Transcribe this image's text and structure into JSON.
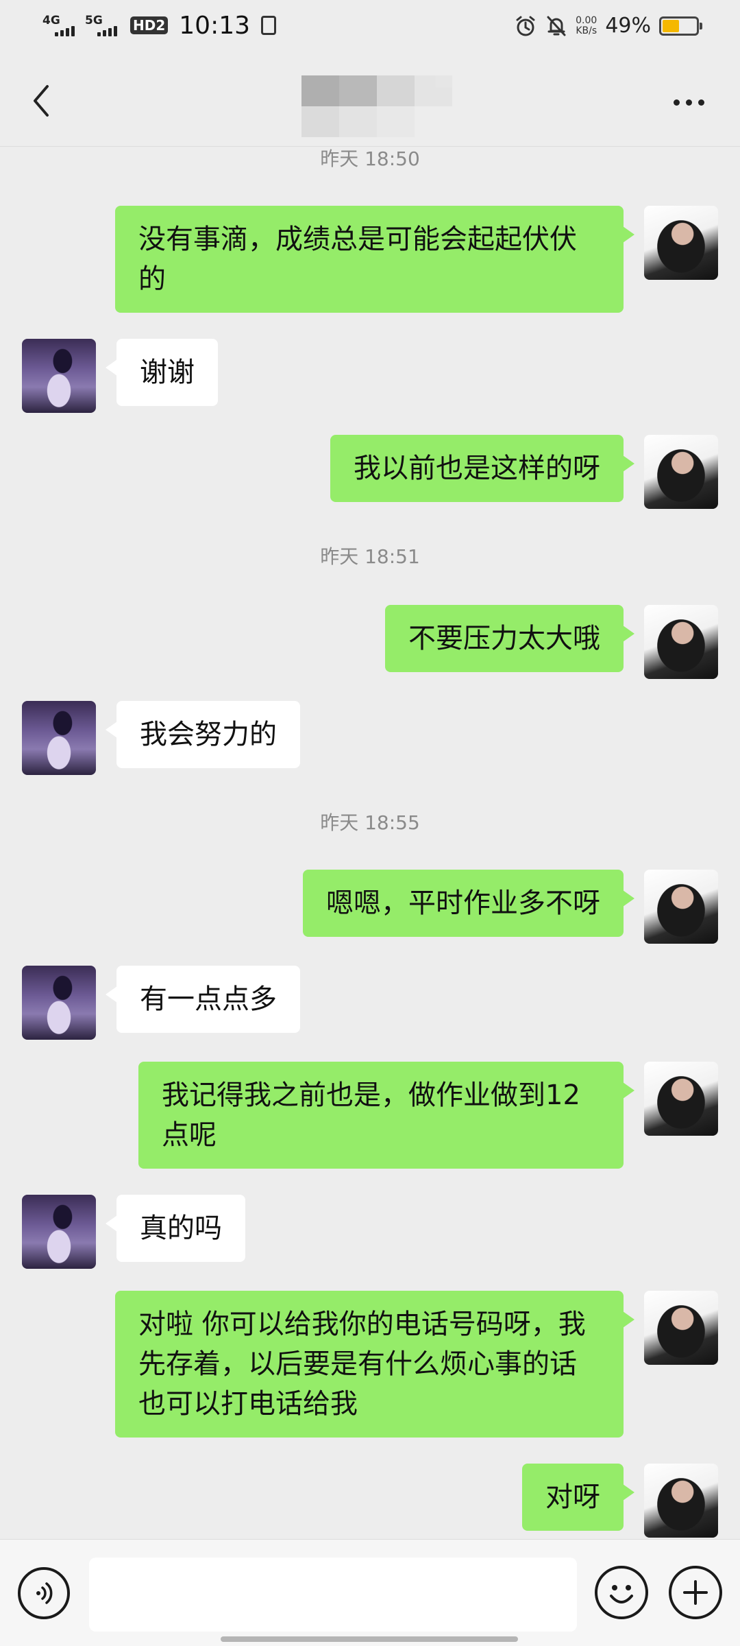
{
  "status_bar": {
    "network_1": "4G",
    "network_2": "5G",
    "hd_badge": "HD2",
    "time": "10:13",
    "net_speed_value": "0.00",
    "net_speed_unit": "KB/s",
    "battery_percent": "49%",
    "battery_level": 0.49,
    "battery_color": "#f5b800"
  },
  "nav": {
    "back_icon": "chevron-left-icon",
    "title_redacted": true,
    "more_icon": "more-horizontal-icon"
  },
  "chat": {
    "timestamps": [
      "昨天 18:50",
      "昨天 18:51",
      "昨天 18:55"
    ],
    "messages": [
      {
        "from": "me",
        "text": "没有事滴，成绩总是可能会起起伏伏的"
      },
      {
        "from": "peer",
        "text": "谢谢"
      },
      {
        "from": "me",
        "text": "我以前也是这样的呀"
      },
      {
        "from": "me",
        "text": "不要压力太大哦"
      },
      {
        "from": "peer",
        "text": "我会努力的"
      },
      {
        "from": "me",
        "text": "嗯嗯，平时作业多不呀"
      },
      {
        "from": "peer",
        "text": "有一点点多"
      },
      {
        "from": "me",
        "text": "我记得我之前也是，做作业做到12点呢"
      },
      {
        "from": "peer",
        "text": "真的吗"
      },
      {
        "from": "me",
        "text": "对啦  你可以给我你的电话号码呀，我先存着，以后要是有什么烦心事的话也可以打电话给我"
      },
      {
        "from": "me",
        "text": "对呀"
      }
    ]
  },
  "input_bar": {
    "voice_icon": "voice-icon",
    "text_value": "",
    "emoji_icon": "emoji-icon",
    "plus_icon": "plus-icon"
  },
  "colors": {
    "background": "#ededed",
    "my_bubble": "#95ec69",
    "peer_bubble": "#ffffff",
    "timestamp_text": "#8a8a8a"
  }
}
